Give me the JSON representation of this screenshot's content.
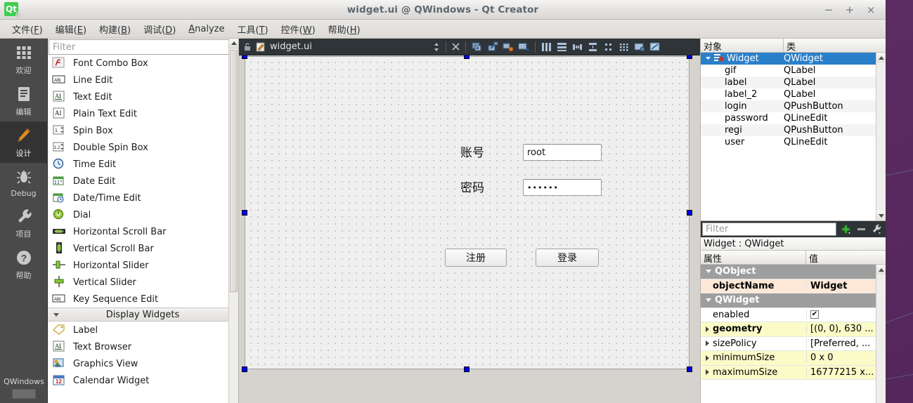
{
  "window": {
    "title": "widget.ui @ QWindows - Qt Creator",
    "logo_text": "Qt",
    "minimize": "−",
    "maximize": "+",
    "close": "×"
  },
  "menubar": {
    "items": [
      {
        "text": "文件(F)",
        "mnemonic": "F"
      },
      {
        "text": "编辑(E)",
        "mnemonic": "E"
      },
      {
        "text": "构建(B)",
        "mnemonic": "B"
      },
      {
        "text": "调试(D)",
        "mnemonic": "D"
      },
      {
        "text": "Analyze",
        "mnemonic": "A"
      },
      {
        "text": "工具(T)",
        "mnemonic": "T"
      },
      {
        "text": "控件(W)",
        "mnemonic": "W"
      },
      {
        "text": "帮助(H)",
        "mnemonic": "H"
      }
    ]
  },
  "modebar": {
    "items": [
      {
        "label": "欢迎",
        "icon": "grid-icon",
        "active": false
      },
      {
        "label": "编辑",
        "icon": "document-icon",
        "active": false
      },
      {
        "label": "设计",
        "icon": "pencil-icon",
        "active": true
      },
      {
        "label": "Debug",
        "icon": "bug-icon",
        "active": false
      },
      {
        "label": "项目",
        "icon": "wrench-icon",
        "active": false
      },
      {
        "label": "帮助",
        "icon": "question-icon",
        "active": false
      }
    ],
    "kit": "QWindows"
  },
  "widgetbox": {
    "filter_placeholder": "Filter",
    "items": [
      {
        "label": "Font Combo Box",
        "icon": "font-combo-box-icon",
        "type": "widget"
      },
      {
        "label": "Line Edit",
        "icon": "line-edit-icon",
        "type": "widget"
      },
      {
        "label": "Text Edit",
        "icon": "text-edit-icon",
        "type": "widget"
      },
      {
        "label": "Plain Text Edit",
        "icon": "plain-text-edit-icon",
        "type": "widget"
      },
      {
        "label": "Spin Box",
        "icon": "spin-box-icon",
        "type": "widget"
      },
      {
        "label": "Double Spin Box",
        "icon": "double-spin-box-icon",
        "type": "widget"
      },
      {
        "label": "Time Edit",
        "icon": "time-edit-icon",
        "type": "widget"
      },
      {
        "label": "Date Edit",
        "icon": "date-edit-icon",
        "type": "widget"
      },
      {
        "label": "Date/Time Edit",
        "icon": "date-time-edit-icon",
        "type": "widget"
      },
      {
        "label": "Dial",
        "icon": "dial-icon",
        "type": "widget"
      },
      {
        "label": "Horizontal Scroll Bar",
        "icon": "horizontal-scroll-bar-icon",
        "type": "widget"
      },
      {
        "label": "Vertical Scroll Bar",
        "icon": "vertical-scroll-bar-icon",
        "type": "widget"
      },
      {
        "label": "Horizontal Slider",
        "icon": "horizontal-slider-icon",
        "type": "widget"
      },
      {
        "label": "Vertical Slider",
        "icon": "vertical-slider-icon",
        "type": "widget"
      },
      {
        "label": "Key Sequence Edit",
        "icon": "key-sequence-edit-icon",
        "type": "widget"
      },
      {
        "label": "Display Widgets",
        "icon": "collapse-icon",
        "type": "category"
      },
      {
        "label": "Label",
        "icon": "label-icon",
        "type": "widget"
      },
      {
        "label": "Text Browser",
        "icon": "text-browser-icon",
        "type": "widget"
      },
      {
        "label": "Graphics View",
        "icon": "graphics-view-icon",
        "type": "widget"
      },
      {
        "label": "Calendar Widget",
        "icon": "calendar-widget-icon",
        "type": "widget"
      }
    ]
  },
  "editor_tab": {
    "filename": "widget.ui",
    "lock_icon": "unlocked-icon",
    "file_icon": "ui-file-icon",
    "split_icon": "updown-arrows-icon",
    "close_icon": "close-icon"
  },
  "designer_toolbar": {
    "buttons": [
      {
        "name": "edit-widgets-icon"
      },
      {
        "name": "edit-signals-slots-icon"
      },
      {
        "name": "edit-buddies-icon"
      },
      {
        "name": "edit-tab-order-icon"
      },
      {
        "name": "layout-horizontally-icon"
      },
      {
        "name": "layout-vertically-icon"
      },
      {
        "name": "layout-splitter-horizontal-icon"
      },
      {
        "name": "layout-splitter-vertical-icon"
      },
      {
        "name": "layout-form-icon"
      },
      {
        "name": "layout-grid-icon"
      },
      {
        "name": "break-layout-icon"
      },
      {
        "name": "adjust-size-icon"
      }
    ]
  },
  "form": {
    "labels": [
      {
        "text": "账号",
        "name": "account-label"
      },
      {
        "text": "密码",
        "name": "password-label"
      }
    ],
    "inputs": [
      {
        "value": "root",
        "name": "user-line-edit"
      },
      {
        "value": "••••••",
        "name": "password-line-edit"
      }
    ],
    "buttons": [
      {
        "text": "注册",
        "name": "register-button"
      },
      {
        "text": "登录",
        "name": "login-button"
      }
    ]
  },
  "object_inspector": {
    "columns": [
      "对象",
      "类"
    ],
    "rows": [
      {
        "object": "Widget",
        "class": "QWidget",
        "selected": true,
        "root": true
      },
      {
        "object": "gif",
        "class": "QLabel",
        "selected": false,
        "root": false
      },
      {
        "object": "label",
        "class": "QLabel",
        "selected": false,
        "root": false
      },
      {
        "object": "label_2",
        "class": "QLabel",
        "selected": false,
        "root": false
      },
      {
        "object": "login",
        "class": "QPushButton",
        "selected": false,
        "root": false
      },
      {
        "object": "password",
        "class": "QLineEdit",
        "selected": false,
        "root": false
      },
      {
        "object": "regi",
        "class": "QPushButton",
        "selected": false,
        "root": false
      },
      {
        "object": "user",
        "class": "QLineEdit",
        "selected": false,
        "root": false
      }
    ]
  },
  "property_editor": {
    "filter_placeholder": "Filter",
    "add_icon": "plus-icon",
    "remove_icon": "minus-icon",
    "configure_icon": "wrench-icon",
    "subject": "Widget : QWidget",
    "columns": [
      "属性",
      "值"
    ],
    "rows": [
      {
        "property": "QObject",
        "value": "",
        "style": "group"
      },
      {
        "property": "objectName",
        "value": "Widget",
        "style": "name"
      },
      {
        "property": "QWidget",
        "value": "",
        "style": "group"
      },
      {
        "property": "enabled",
        "value": "✔",
        "style": "white",
        "is_checkbox": true
      },
      {
        "property": "geometry",
        "value": "[(0, 0), 630 ...",
        "style": "yellow",
        "expandable": true,
        "bold": true
      },
      {
        "property": "sizePolicy",
        "value": "[Preferred, ...",
        "style": "white",
        "expandable": true
      },
      {
        "property": "minimumSize",
        "value": "0 x 0",
        "style": "yellow",
        "expandable": true
      },
      {
        "property": "maximumSize",
        "value": "16777215 x...",
        "style": "yellow",
        "expandable": true
      }
    ]
  },
  "colors": {
    "accent_selection": "#2a7fc9",
    "desktop": "#5e2a66",
    "mode_active_icon": "#e08a1e",
    "handle": "#0000ff",
    "qt_green": "#41cd52"
  }
}
